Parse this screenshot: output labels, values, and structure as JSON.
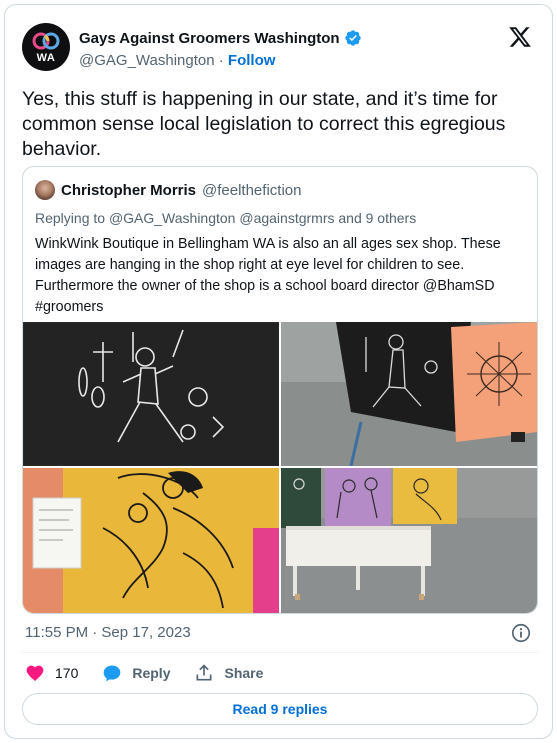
{
  "author": {
    "name": "Gays Against Groomers Washington",
    "handle": "@GAG_Washington",
    "separator": "·",
    "follow_label": "Follow",
    "avatar_text": "WA",
    "verified": true
  },
  "tweet_text": "Yes, this stuff is happening in our state, and it’s time for common sense local legislation to correct this egregious behavior.",
  "quoted": {
    "name": "Christopher Morris",
    "handle": "@feelthefiction",
    "replying_prefix": "Replying to",
    "replying_users": "@GAG_Washington @againstgrmrs",
    "replying_suffix": "and 9 others",
    "text": "WinkWink Boutique in Bellingham WA is also an all ages sex shop. These images are hanging in the shop right at eye level for children to see. Furthermore the owner of the shop is a school board director @BhamSD #groomers",
    "image_count": 4
  },
  "timestamp": "11:55 PM · Sep 17, 2023",
  "actions": {
    "like_count": "170",
    "reply_label": "Reply",
    "share_label": "Share"
  },
  "read_replies_label": "Read 9 replies",
  "colors": {
    "link": "#006fd6",
    "secondary_text": "#536471",
    "heart": "#f91880",
    "border": "#cfd9de",
    "verified": "#1d9bf0"
  },
  "icons": [
    "x-logo-icon",
    "verified-badge-icon",
    "info-icon",
    "heart-icon",
    "reply-bubble-icon",
    "share-icon"
  ]
}
